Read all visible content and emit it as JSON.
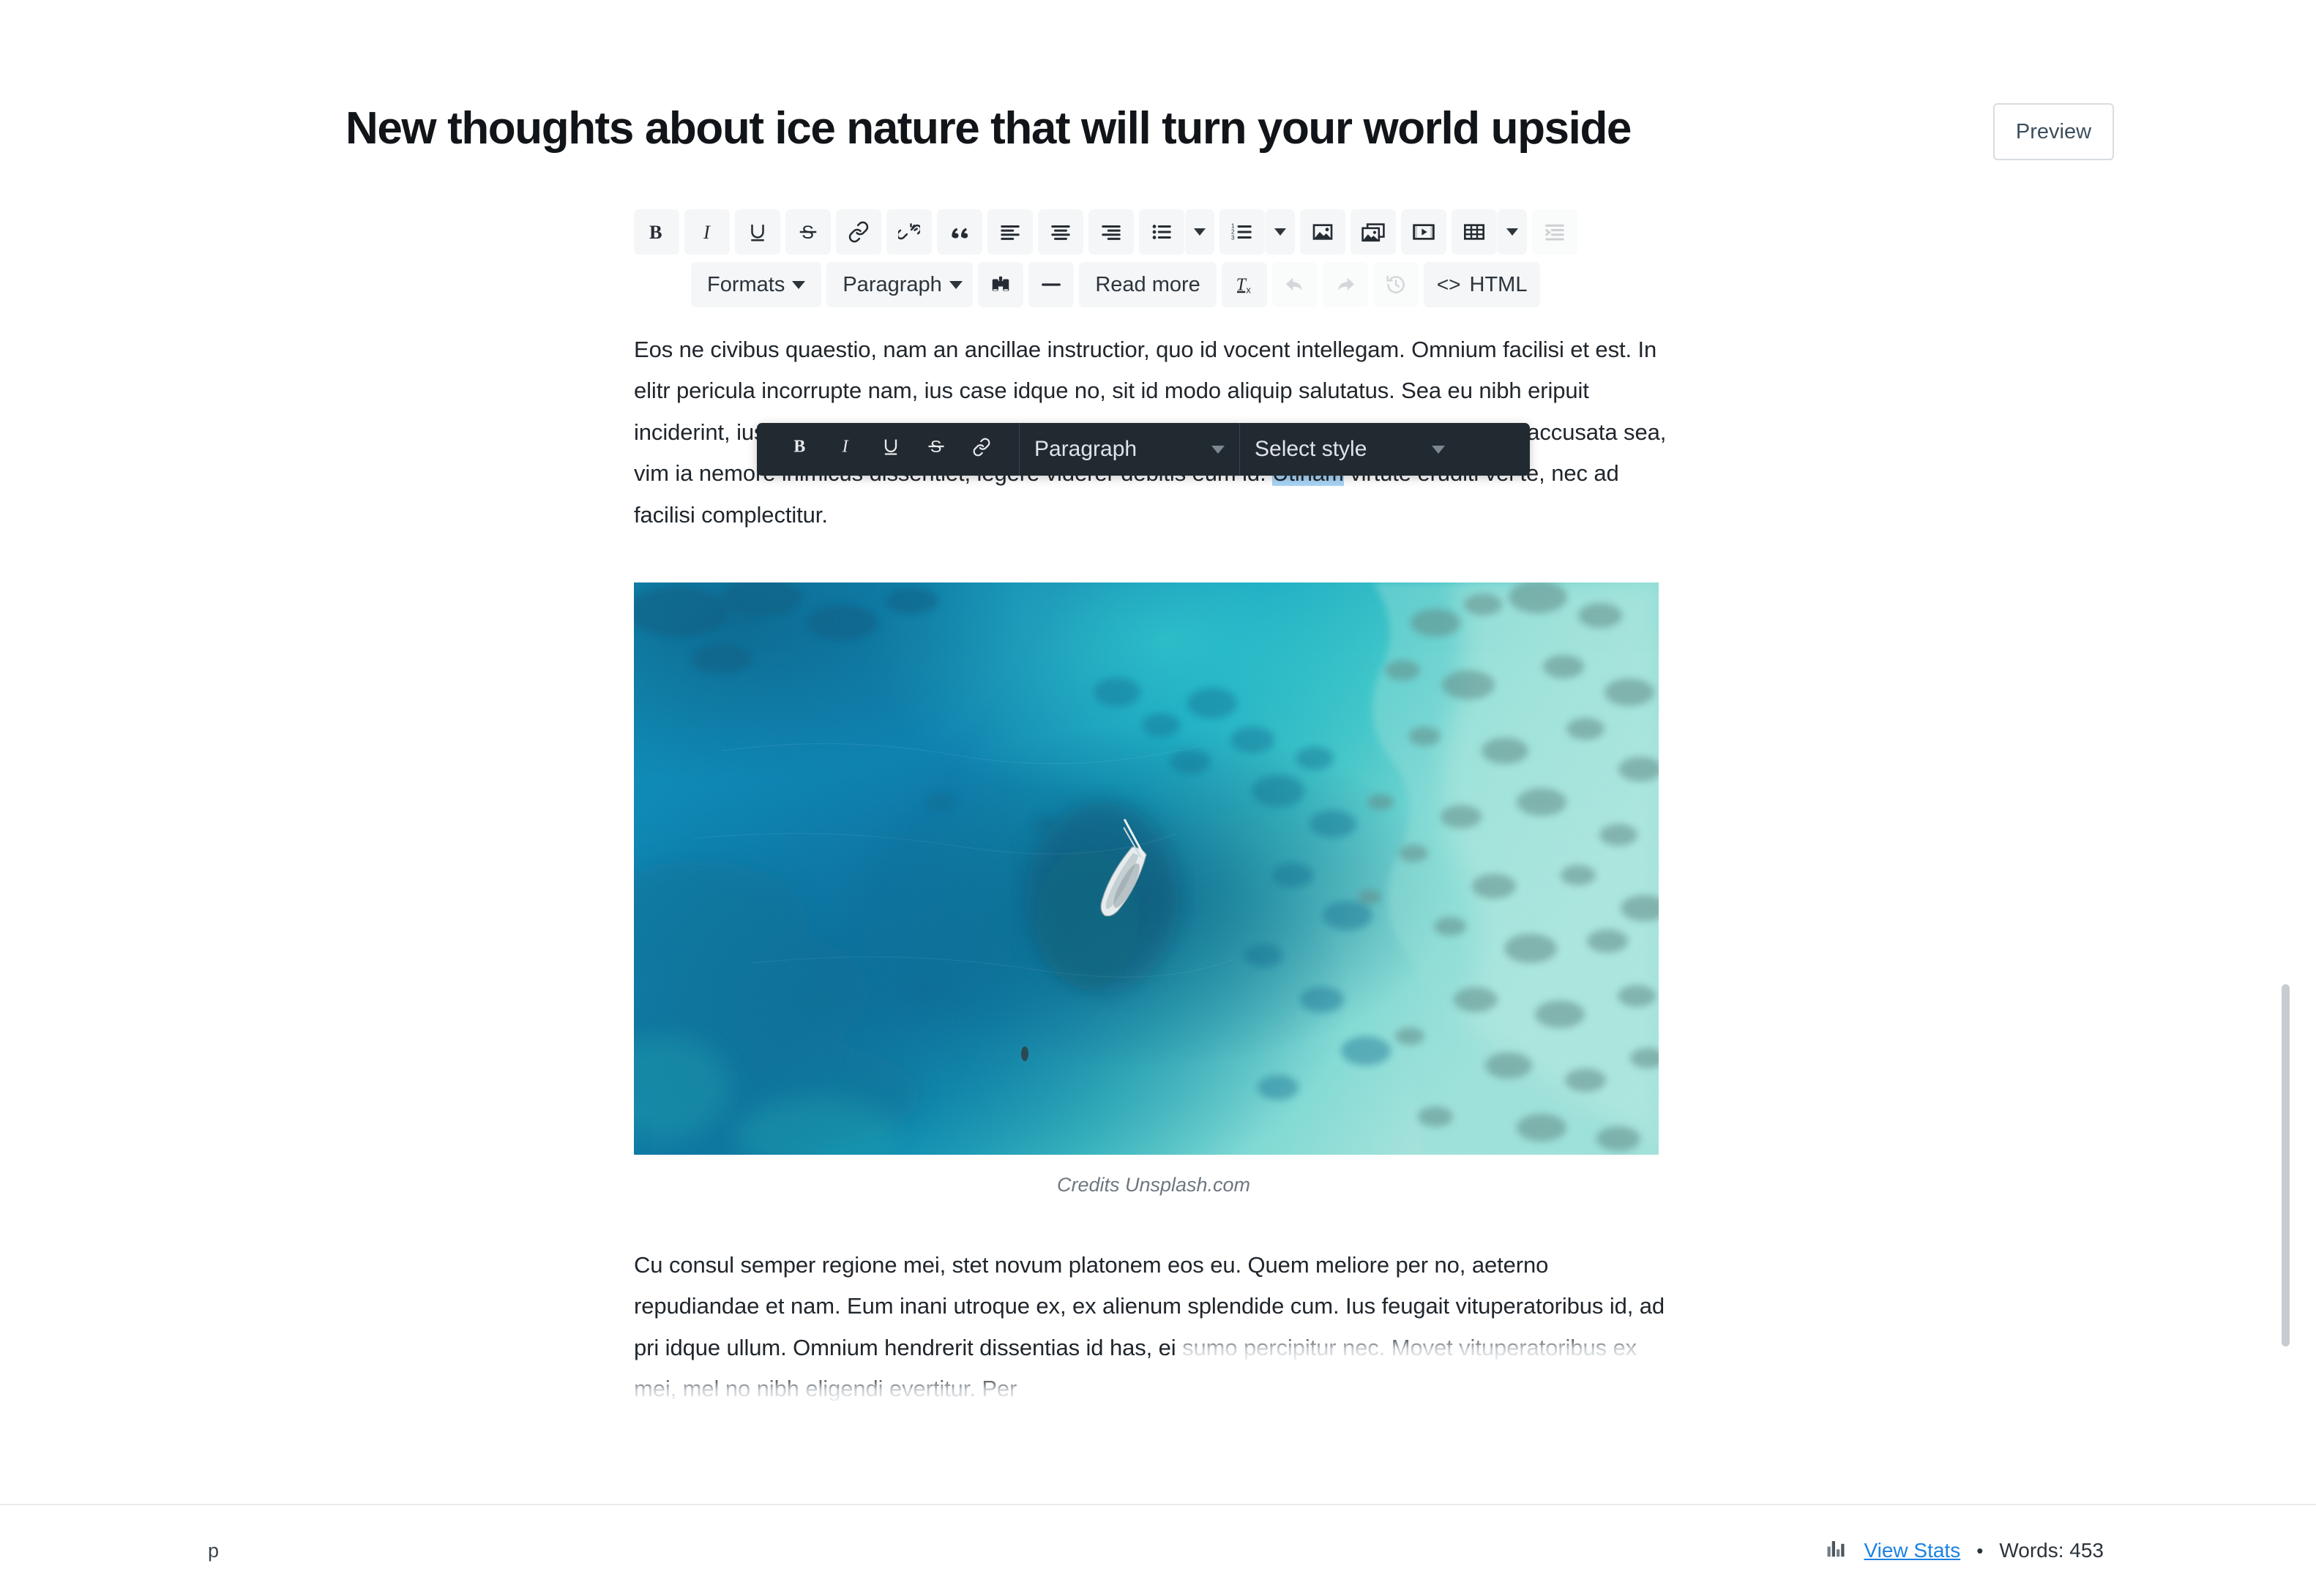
{
  "header": {
    "post_title": "New thoughts about ice nature that will turn your world upside",
    "preview_label": "Preview"
  },
  "toolbar": {
    "row1": [
      {
        "name": "bold",
        "label": "B",
        "icon": "bold-icon"
      },
      {
        "name": "italic",
        "label": "I",
        "icon": "italic-icon"
      },
      {
        "name": "underline",
        "label": "U",
        "icon": "underline-icon"
      },
      {
        "name": "strikethrough",
        "label": "S",
        "icon": "strikethrough-icon"
      },
      {
        "name": "insert-link",
        "label": "",
        "icon": "link-icon"
      },
      {
        "name": "remove-link",
        "label": "",
        "icon": "unlink-icon"
      },
      {
        "name": "blockquote",
        "label": "",
        "icon": "quote-icon"
      },
      {
        "name": "align-left",
        "label": "",
        "icon": "align-left-icon"
      },
      {
        "name": "align-center",
        "label": "",
        "icon": "align-center-icon"
      },
      {
        "name": "align-right",
        "label": "",
        "icon": "align-right-icon"
      },
      {
        "name": "bulleted-list",
        "label": "",
        "icon": "bulleted-list-icon"
      },
      {
        "name": "numbered-list",
        "label": "",
        "icon": "numbered-list-icon"
      },
      {
        "name": "insert-image",
        "label": "",
        "icon": "image-icon"
      },
      {
        "name": "insert-gallery",
        "label": "",
        "icon": "gallery-icon"
      },
      {
        "name": "insert-video",
        "label": "",
        "icon": "video-icon"
      },
      {
        "name": "insert-table",
        "label": "",
        "icon": "table-icon"
      },
      {
        "name": "indent",
        "label": "",
        "icon": "indent-icon"
      }
    ],
    "formats_label": "Formats",
    "paragraph_label": "Paragraph",
    "find_label": "",
    "horizontal_rule_label": "",
    "read_more_label": "Read more",
    "clear_formatting_label": "",
    "undo_label": "",
    "redo_label": "",
    "history_label": "",
    "html_label": "HTML",
    "html_icon_label": "<>"
  },
  "floating_toolbar": {
    "bold_label": "B",
    "italic_label": "I",
    "underline_label": "U",
    "strikethrough_label": "S",
    "link_label": "",
    "paragraph_label": "Paragraph",
    "select_style_label": "Select style"
  },
  "content": {
    "paragraph_1_part_a": "Eos ne civibus quaestio, nam an ancillae instructior, quo id vocent intellegam. Omnium facilisi et est. In elitr pericula incorrupte nam, ius case idque no, sit id modo aliquip salutatus. Sea eu nibh eripuit inciderint, ius ei quas explicatissimi, nec labores diligentia incorrupte eu. Te tantas doctus accusata sea, vim ia nemore inimicus dissentiet, legere viderer debitis eum id. ",
    "selected_word": "Utinam",
    "paragraph_1_part_b": " virtute eruditi vel te, nec ad facilisi complectitur.",
    "figure_caption": "Credits Unsplash.com",
    "paragraph_2": "Cu consul semper regione mei, stet novum platonem eos eu. Quem meliore per no, aeterno repudiandae et nam. Eum inani utroque ex, ex alienum splendide cum. Ius feugait vituperatoribus id, ad pri idque ullum. Omnium hendrerit dissentias id has, ei ",
    "paragraph_2_fading": "sumo percipitur nec. Movet vituperatoribus ex mei, mel no nibh eligendi evertitur. Per"
  },
  "status_bar": {
    "element_path": "p",
    "view_stats_label": "View Stats",
    "separator": "•",
    "word_count_label": "Words: 453"
  },
  "colors": {
    "accent_link": "#1b82e2",
    "toolbar_bg": "#f4f6f7",
    "float_toolbar_bg": "#222a31",
    "selection_highlight": "#a8d4f5",
    "text": "#20262c"
  }
}
